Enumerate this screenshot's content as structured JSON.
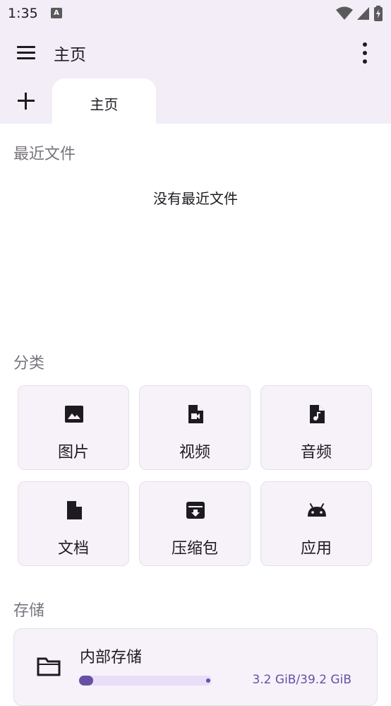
{
  "status_bar": {
    "time": "1:35",
    "notification_icon": "A"
  },
  "app_bar": {
    "title": "主页",
    "menu_icon": "hamburger-menu-icon",
    "more_icon": "more-vert-icon"
  },
  "tabs": [
    {
      "label": "主页",
      "selected": true
    }
  ],
  "recent": {
    "title": "最近文件",
    "empty_text": "没有最近文件"
  },
  "categories": {
    "title": "分类",
    "items": [
      {
        "label": "图片",
        "icon": "image-icon"
      },
      {
        "label": "视频",
        "icon": "video-file-icon"
      },
      {
        "label": "音频",
        "icon": "audio-file-icon"
      },
      {
        "label": "文档",
        "icon": "document-icon"
      },
      {
        "label": "压缩包",
        "icon": "archive-icon"
      },
      {
        "label": "应用",
        "icon": "android-icon"
      }
    ]
  },
  "storage": {
    "title": "存储",
    "items": [
      {
        "name": "内部存储",
        "size_text": "3.2 GiB/39.2 GiB",
        "used_fraction": 0.082
      }
    ]
  },
  "colors": {
    "header_bg": "#f2edf7",
    "accent": "#6750a4",
    "card_bg": "#f7f2fa"
  }
}
